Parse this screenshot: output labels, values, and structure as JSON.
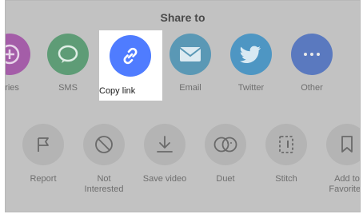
{
  "title": "Share to",
  "share_targets": [
    {
      "label": "ories",
      "icon": "stories-icon",
      "color": "#a45da8"
    },
    {
      "label": "SMS",
      "icon": "sms-icon",
      "color": "#5e9c76"
    },
    {
      "label": "Copy link",
      "icon": "link-icon",
      "color": "#4f7cff"
    },
    {
      "label": "Email",
      "icon": "email-icon",
      "color": "#5a98b5"
    },
    {
      "label": "Twitter",
      "icon": "twitter-icon",
      "color": "#4e96c3"
    },
    {
      "label": "Other",
      "icon": "more-icon",
      "color": "#5a79bf"
    }
  ],
  "actions": [
    {
      "label": "Report",
      "icon": "flag-icon"
    },
    {
      "label": "Not\nInterested",
      "icon": "block-icon"
    },
    {
      "label": "Save video",
      "icon": "download-icon"
    },
    {
      "label": "Duet",
      "icon": "duet-icon"
    },
    {
      "label": "Stitch",
      "icon": "stitch-icon"
    },
    {
      "label": "Add to\nFavorites",
      "icon": "bookmark-icon"
    }
  ]
}
